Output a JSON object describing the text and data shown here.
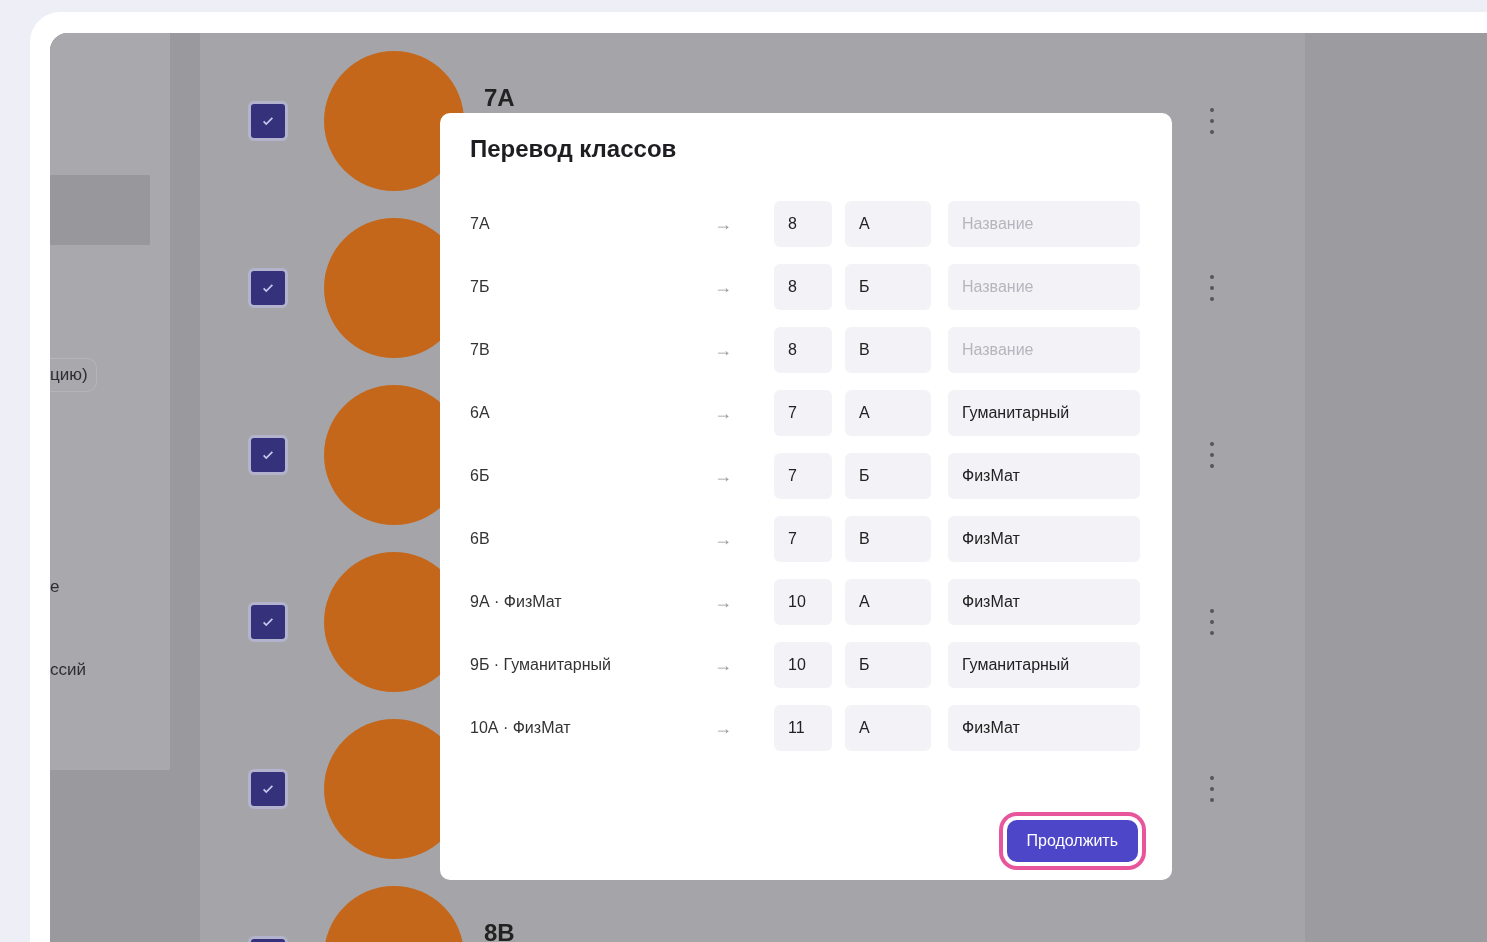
{
  "sidebar": {
    "items": [
      {
        "selected": true
      },
      {
        "label": "цию)",
        "selected": false
      },
      {
        "label": "е",
        "selected": false
      },
      {
        "label": "ссий",
        "selected": false
      }
    ]
  },
  "list": [
    {
      "name": "7А",
      "checked": true
    },
    {
      "checked": true
    },
    {
      "checked": true
    },
    {
      "checked": true
    },
    {
      "checked": true
    },
    {
      "name": "8В",
      "checked": true
    }
  ],
  "dialog": {
    "title": "Перевод классов",
    "rows": [
      {
        "source": "7А",
        "arrow": "→",
        "grade": "8",
        "letter": "А",
        "placeholder": "Название"
      },
      {
        "source": "7Б",
        "arrow": "→",
        "grade": "8",
        "letter": "Б",
        "placeholder": "Название"
      },
      {
        "source": "7В",
        "arrow": "→",
        "grade": "8",
        "letter": "В",
        "placeholder": "Название"
      },
      {
        "source": "6А",
        "arrow": "→",
        "grade": "7",
        "letter": "А",
        "profile": "Гуманитарный"
      },
      {
        "source": "6Б",
        "arrow": "→",
        "grade": "7",
        "letter": "Б",
        "profile": "ФизМат"
      },
      {
        "source": "6В",
        "arrow": "→",
        "grade": "7",
        "letter": "В",
        "profile": "ФизМат"
      },
      {
        "source": "9А · ФизМат",
        "arrow": "→",
        "grade": "10",
        "letter": "А",
        "profile": "ФизМат"
      },
      {
        "source": "9Б · Гуманитарный",
        "arrow": "→",
        "grade": "10",
        "letter": "Б",
        "profile": "Гуманитарный"
      },
      {
        "source": "10А · ФизМат",
        "arrow": "→",
        "grade": "11",
        "letter": "А",
        "profile": "ФизМат"
      }
    ],
    "button": {
      "label": "Продолжить",
      "highlighted": true
    }
  }
}
